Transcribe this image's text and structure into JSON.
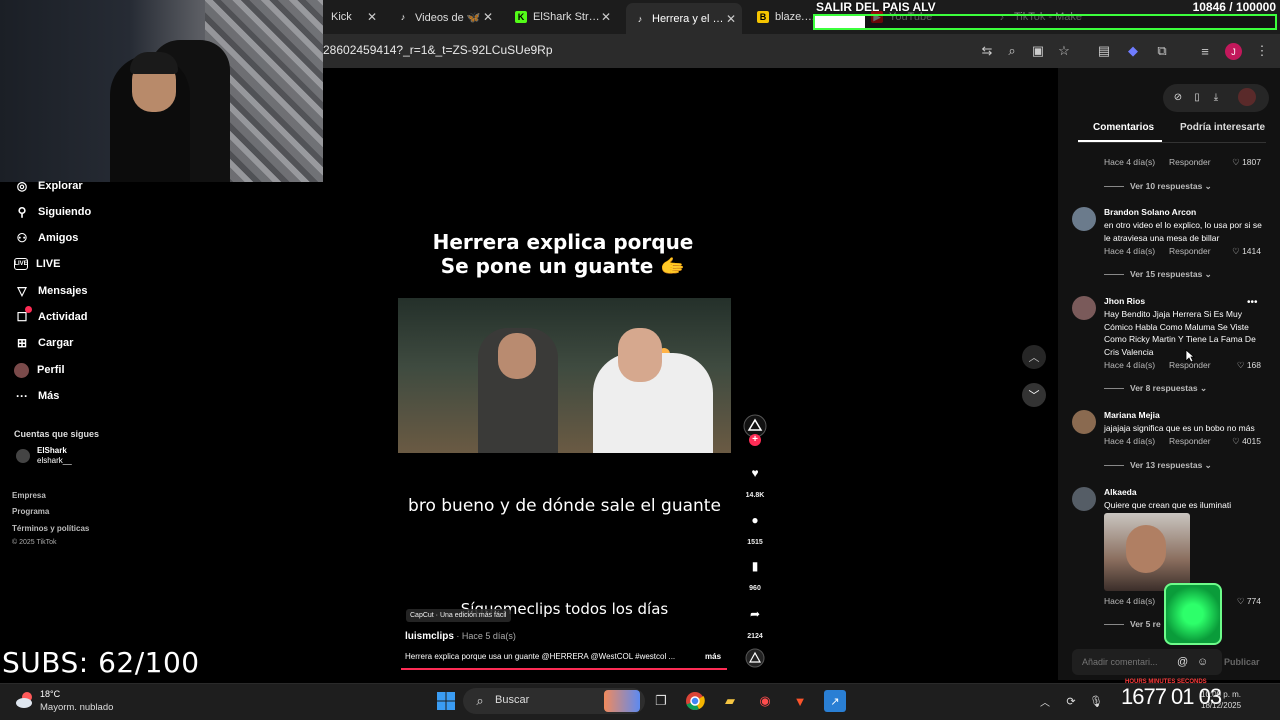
{
  "browser": {
    "tabs": [
      {
        "label": "Kick",
        "favicon_color": "#53fc18",
        "active": false
      },
      {
        "label": "Videos de 🦋",
        "favicon_color": "#ffffff",
        "active": false
      },
      {
        "label": "ElShark Stream",
        "favicon_color": "#53fc18",
        "active": false
      },
      {
        "label": "Herrera y el sig",
        "favicon_color": "#ffffff",
        "active": true
      },
      {
        "label": "blaze.stream",
        "favicon_color": "#f5c400",
        "active": false
      },
      {
        "label": "YouTube",
        "favicon_color": "#ff0000",
        "active": false
      },
      {
        "label": "TikTok - Make",
        "favicon_color": "#ffffff",
        "active": false
      }
    ],
    "url": "28602459414?_r=1&_t=ZS-92LCuSUe9Rp",
    "toolbar_icons": [
      "translate-icon",
      "zoom-icon",
      "cast-icon",
      "star-icon",
      "screenshot-icon",
      "extension-ai-icon",
      "extensions-icon",
      "media-icon",
      "profile-avatar",
      "menu-icon"
    ],
    "profile_initial": "J"
  },
  "overlay": {
    "goal_title": "SALIR DEL PAIS ALV",
    "goal_counter": "10846  / 100000",
    "goal_fraction": 0.108,
    "subs": "SUBS: 62/100",
    "timer": "1677 01 03",
    "timer_labels": "HOURS  MINUTES  SECONDS"
  },
  "leftnav": {
    "items": [
      {
        "label": "Explorar",
        "icon": "compass-icon"
      },
      {
        "label": "Siguiendo",
        "icon": "following-icon"
      },
      {
        "label": "Amigos",
        "icon": "friends-icon"
      },
      {
        "label": "LIVE",
        "icon": "live-icon"
      },
      {
        "label": "Mensajes",
        "icon": "messages-icon"
      },
      {
        "label": "Actividad",
        "icon": "activity-icon"
      },
      {
        "label": "Cargar",
        "icon": "upload-icon"
      },
      {
        "label": "Perfil",
        "icon": "profile-icon"
      },
      {
        "label": "Más",
        "icon": "more-icon"
      }
    ],
    "following_title": "Cuentas que sigues",
    "account": {
      "name": "ElShark",
      "handle": "elshark__"
    },
    "footer": [
      "Empresa",
      "Programa",
      "Términos y políticas"
    ],
    "copyright": "© 2025 TikTok"
  },
  "video": {
    "title_line1": "Herrera explica porque",
    "title_line2": "Se pone un guante 🫱",
    "caption1": "bro bueno y de dónde sale el guante",
    "caption2": "Síguemeclips todos los días",
    "capcut": "CapCut · Una edición más fácil",
    "author": "luismclips",
    "posted": " · Hace 5 día(s)",
    "description": "Herrera explica porque usa un guante @HERRERA @WestCOL #westcol ...",
    "more": "más",
    "progress_fraction": 1.0,
    "actions": {
      "likes": "14.8K",
      "comments": "1515",
      "saves": "960",
      "shares": "2124"
    }
  },
  "comments_panel": {
    "tab_comments": "Comentarios",
    "tab_interest": "Podría interesarte",
    "reply_label": "Responder",
    "input_placeholder": "Añadir comentari...",
    "publish": "Publicar",
    "comments": [
      {
        "user": "",
        "text": "",
        "date": "Hace 4 día(s)",
        "likes": "1807",
        "replies": "Ver 10 respuestas"
      },
      {
        "user": "Brandon Solano Arcon",
        "text": "en otro video el lo explico, lo usa por si se le atraviesa una mesa de billar",
        "date": "Hace 4 día(s)",
        "likes": "1414",
        "replies": "Ver 15 respuestas"
      },
      {
        "user": "Jhon Rios",
        "text": "Hay Bendito Jjaja Herrera Si Es Muy Cómico Habla Como Maluma Se Viste Como Ricky Martin Y Tiene La Fama De Cris Valencia",
        "date": "Hace 4 día(s)",
        "likes": "168",
        "replies": "Ver 8 respuestas"
      },
      {
        "user": "Mariana Mejia",
        "text": "jajajaja significa que es un bobo no más",
        "date": "Hace 4 día(s)",
        "likes": "4015",
        "replies": "Ver 13 respuestas"
      },
      {
        "user": "Alkaeda",
        "text": "Quiere que crean que es iluminati",
        "date": "Hace 4 día(s)",
        "likes": "774",
        "replies": "Ver 5 re"
      }
    ]
  },
  "taskbar": {
    "weather_temp": "18°C",
    "weather_desc": "Mayorm. nublado",
    "search": "Buscar",
    "clock_time": "10:09 p. m.",
    "clock_date": "18/12/2025"
  }
}
